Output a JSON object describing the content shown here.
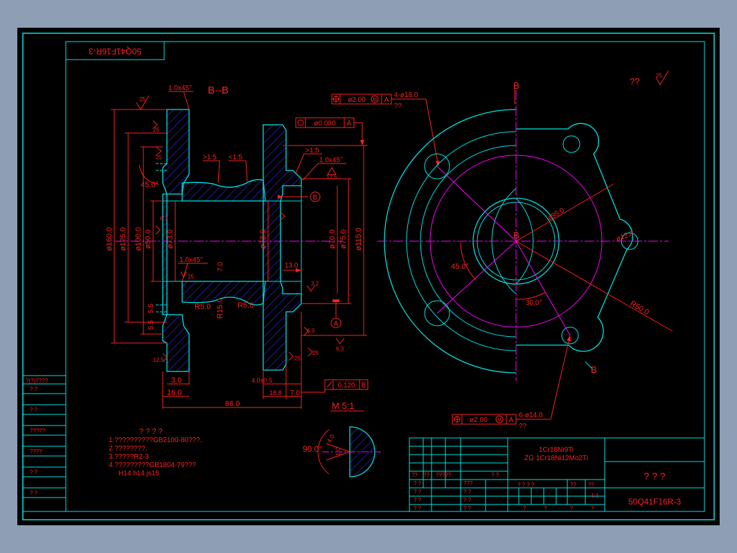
{
  "colors": {
    "frame": "#00e5e5",
    "dim": "#ff2020",
    "part": "#00e5e5",
    "center": "#ff00ff",
    "hatch": "#3030ff",
    "text": "#ff2020",
    "bg": "#000000"
  },
  "drawing_number_rotated": "50Q41F16R-3",
  "section_title": "B--B",
  "section_mark": "B",
  "roughness": {
    "r25": "25",
    "r12_5": "12.5",
    "r6_3": "6.3",
    "r3_2": "3.2",
    "corner": "??"
  },
  "chamfer": "1.0x45°",
  "slope_gt": ">1:5",
  "slope_lt": "<1:5",
  "slope_gt2": ">1:5",
  "dims": {
    "d160": "ø160.0",
    "d125": "ø125.0",
    "d100": "ø100.0",
    "d50": "ø50.0",
    "d73": "ø73.0",
    "d73b": "ø73.0",
    "d70": "ø70.0",
    "d75": "ø75.0",
    "d115": "ø115.0",
    "a45": "45.0°",
    "r5a": "R5.0",
    "r5b": "R5.0",
    "r15": "R15.0",
    "l7": "7.0",
    "l13": "13.0",
    "l55": "5.5",
    "l3": "3.0",
    "l16": "16.0",
    "l86": "86.0",
    "l40": "4.0±0.5",
    "l188": "18.8",
    "l7b": "7.0",
    "d95": "ø95.0",
    "d12": "ø12.0",
    "a45b": "45.0°",
    "a30": "30.0°",
    "r50": "R50.0",
    "ang90": "90.0°",
    "w4": "4.0",
    "w10": "1.0"
  },
  "gtol": {
    "pos1_val": "ø2.00",
    "pos1_m": "M",
    "pos1_ref": "A",
    "holes1": "4-ø18.0",
    "holes1_q": "??",
    "run_val": "ø0.080",
    "run_ref": "A",
    "perp_val": "0.120",
    "perp_ref": "B",
    "pos2_val": "ø2.00",
    "pos2_m": "M",
    "pos2_ref": "A",
    "holes2": "6-ø14.0",
    "holes2_q": "??"
  },
  "datum_a": "A",
  "datum_b": "B",
  "scale_note": "M 5:1",
  "notes": {
    "title": "? ? ? ?",
    "n1": "1.??????????GB2100-80???.",
    "n2": "2.????????.",
    "n3": "3.?????R2-3",
    "n4": "4.?????????GB1804-79???",
    "n5": "H14  h14  js15"
  },
  "left_table": {
    "header": "?(?)????",
    "rows": [
      "?   ?",
      "?   ?",
      "?????",
      "????",
      "?   ?",
      "?   ?"
    ]
  },
  "title_block": {
    "mat1": "1Cr18Ni9Ti",
    "mat2": "ZG 1Cr18Ni12Mo2Ti",
    "name": "? ? ?",
    "code": "50Q41F16R-3",
    "scale": "1:1",
    "r1a": "??",
    "r1b": "??",
    "r1c": "?????",
    "r1d": "???",
    "r1e": "? ?",
    "q": "? ?",
    "qq": "??",
    "stage": "? ? ? ?",
    "sep": "?"
  }
}
